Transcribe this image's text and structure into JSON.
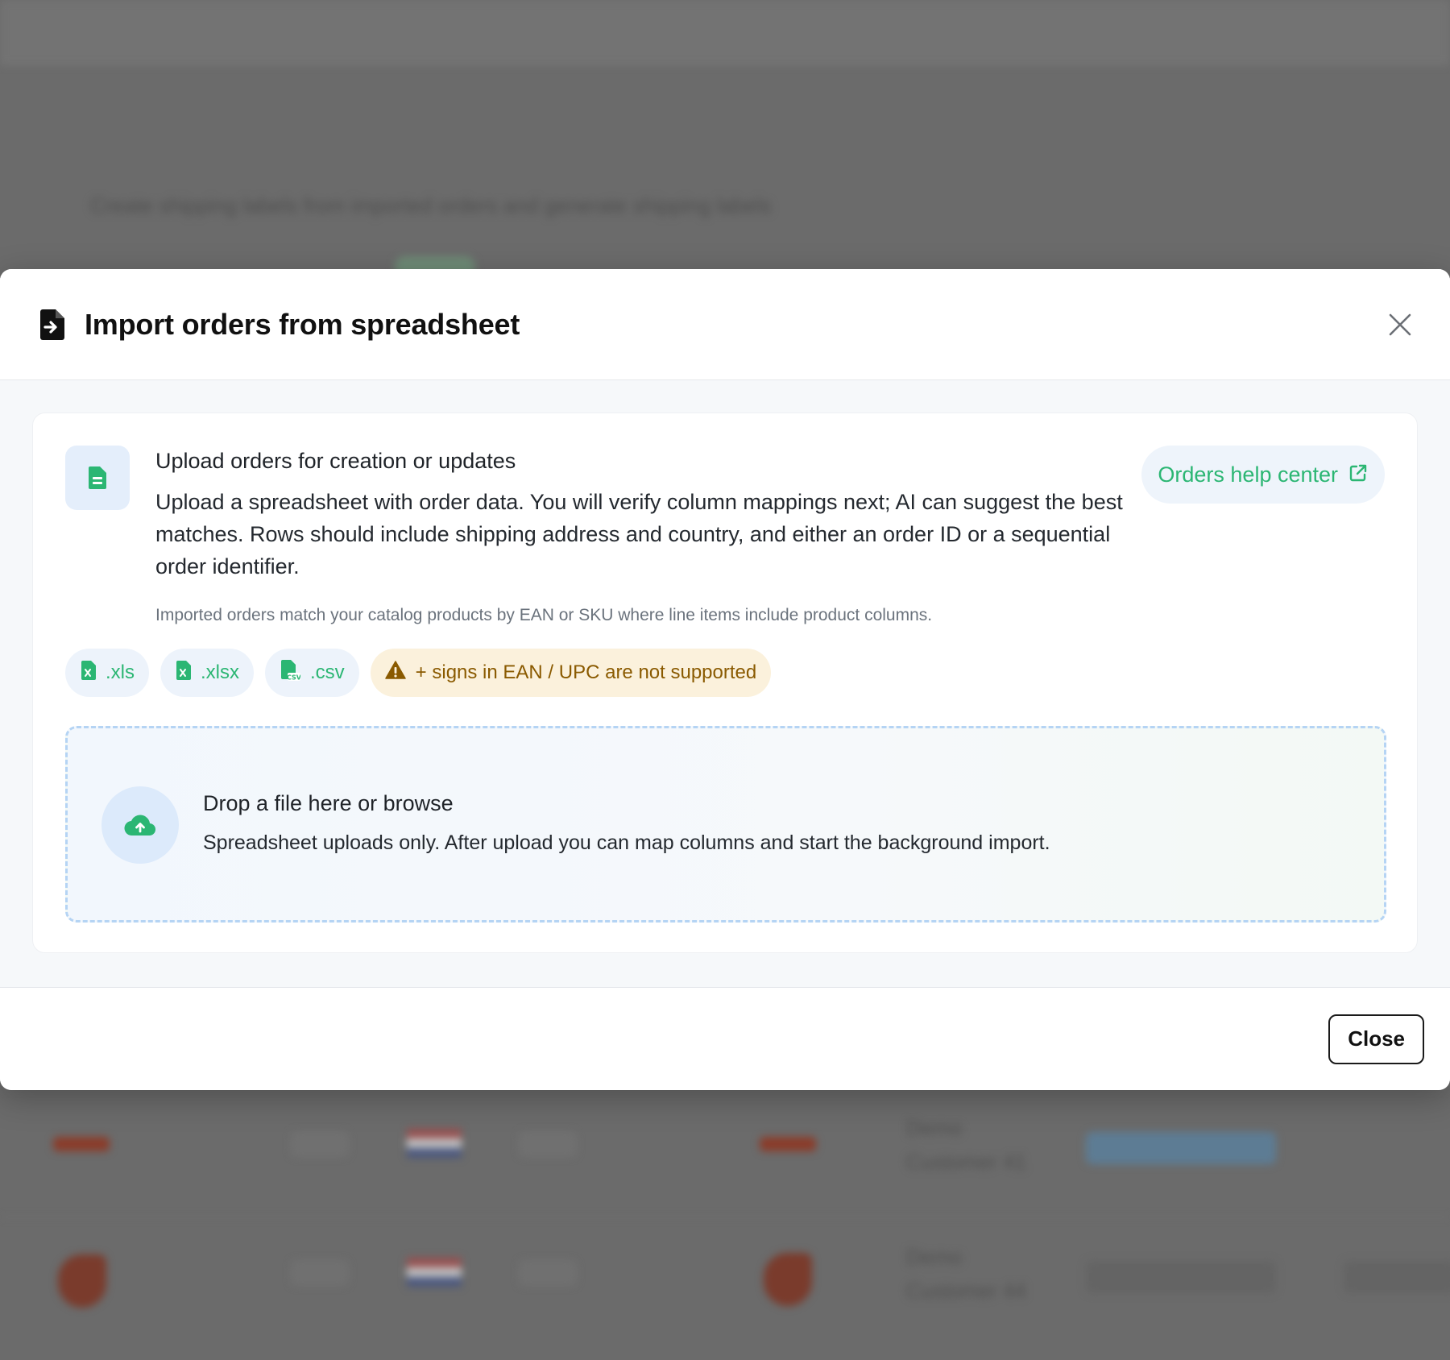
{
  "background": {
    "subtitle": "Create shipping labels from imported orders and generate shipping labels",
    "rows": [
      {
        "customer": "Demo Customer 41"
      },
      {
        "customer": "Demo Customer 44"
      }
    ]
  },
  "modal": {
    "title": "Import orders from spreadsheet",
    "close_icon": "close-icon",
    "header_icon": "file-import-icon",
    "intro": {
      "title": "Upload orders for creation or updates",
      "description": "Upload a spreadsheet with order data. You will verify column mappings next; AI can suggest the best matches. Rows should include shipping address and country, and either an order ID or a sequential order identifier.",
      "note": "Imported orders match your catalog products by EAN or SKU where line items include product columns."
    },
    "help_link": {
      "label": "Orders help center",
      "icon": "external-link-icon"
    },
    "formats": [
      {
        "label": ".xls",
        "icon": "file-excel-icon"
      },
      {
        "label": ".xlsx",
        "icon": "file-excel-icon"
      },
      {
        "label": ".csv",
        "icon": "file-csv-icon"
      }
    ],
    "warning": {
      "label": "+ signs in EAN / UPC are not supported",
      "icon": "warning-icon"
    },
    "dropzone": {
      "title": "Drop a file here or browse",
      "subtitle": "Spreadsheet uploads only. After upload you can map columns and start the background import.",
      "icon": "cloud-upload-icon"
    },
    "footer": {
      "close_label": "Close"
    }
  },
  "colors": {
    "accent_green": "#2bb673",
    "warning_bg": "#fbf1dc",
    "warning_text": "#8a5a00",
    "chip_bg": "#edf3fb",
    "dropzone_border": "#b5d4f4"
  }
}
